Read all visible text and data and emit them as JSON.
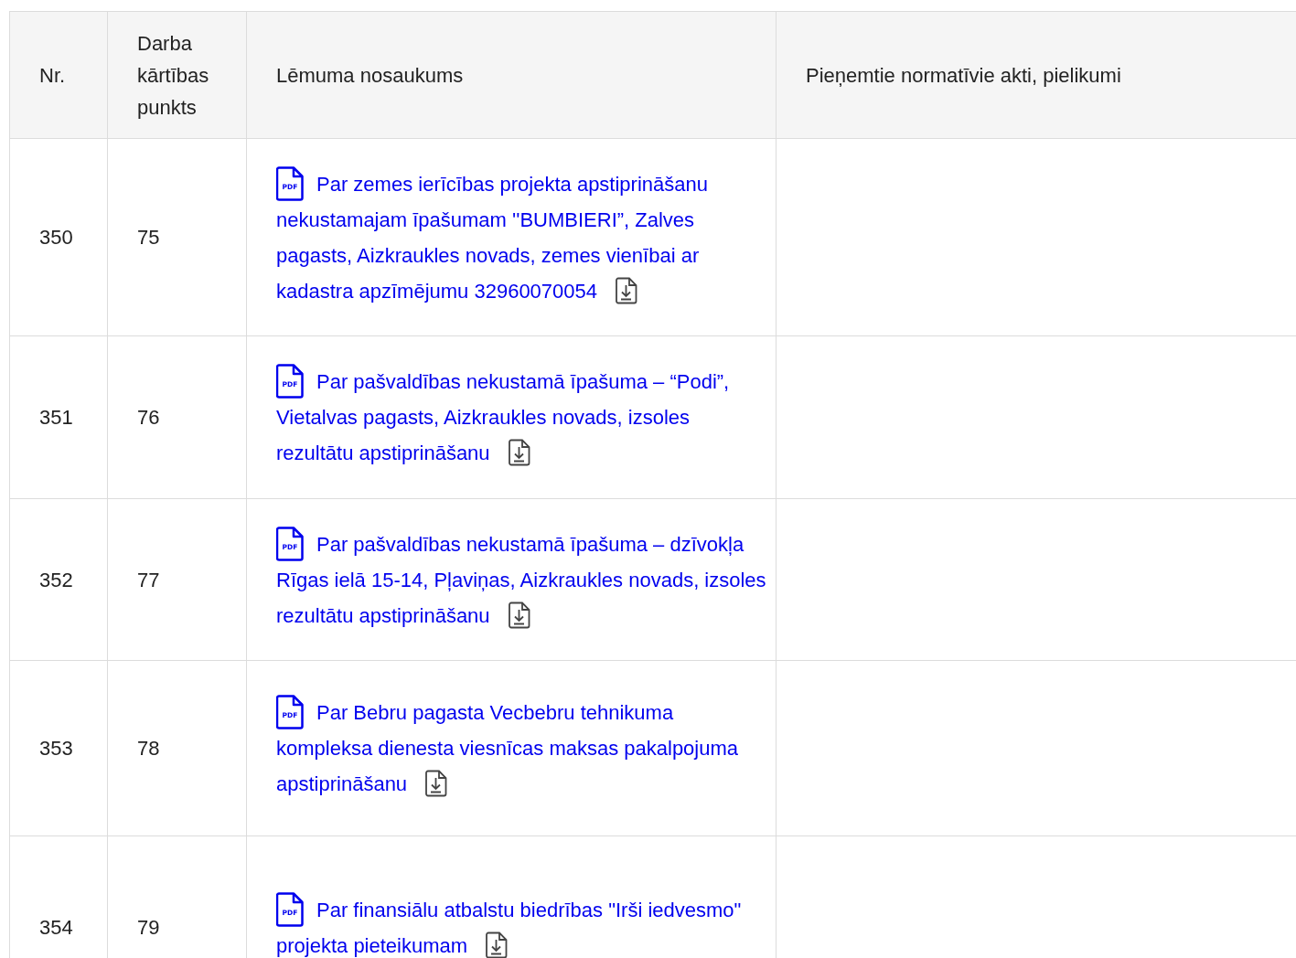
{
  "table": {
    "columns": [
      "Nr.",
      "Darba kārtības punkts",
      "Lēmuma nosaukums",
      "Pieņemtie normatīvie akti, pielikumi"
    ],
    "rows": [
      {
        "nr": "350",
        "item": "75",
        "file_type": "PDF",
        "title": "Par zemes ierīcības projekta apstiprināšanu nekustamajam īpašumam ''BUMBIERI”, Zalves pagasts, Aizkraukles novads, zemes vienībai ar kadastra apzīmējumu 32960070054"
      },
      {
        "nr": "351",
        "item": "76",
        "file_type": "PDF",
        "title": "Par pašvaldības nekustamā īpašuma – “Podi”, Vietalvas pagasts, Aizkraukles novads, izsoles rezultātu apstiprināšanu"
      },
      {
        "nr": "352",
        "item": "77",
        "file_type": "PDF",
        "title": "Par pašvaldības nekustamā īpašuma – dzīvokļa Rīgas ielā 15-14, Pļaviņas, Aizkraukles novads, izsoles rezultātu apstiprināšanu"
      },
      {
        "nr": "353",
        "item": "78",
        "file_type": "PDF",
        "title": "Par Bebru pagasta Vecbebru tehnikuma kompleksa dienesta viesnīcas maksas pakalpojuma apstiprināšanu"
      },
      {
        "nr": "354",
        "item": "79",
        "file_type": "PDF",
        "title": "Par finansiālu atbalstu biedrības \"Irši iedvesmo\" projekta pieteikumam"
      }
    ]
  }
}
